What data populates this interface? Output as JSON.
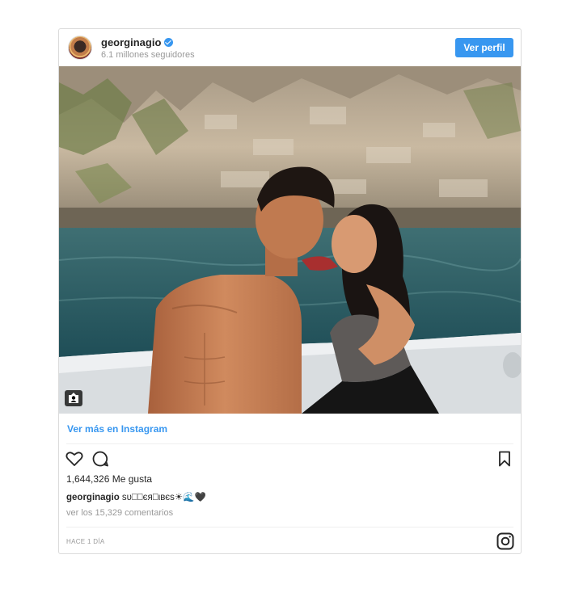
{
  "header": {
    "username": "georginagio",
    "followers": "6.1 millones seguidores",
    "view_profile_label": "Ver perfil"
  },
  "post": {
    "more_link": "Ver más en Instagram",
    "likes": "1,644,326 Me gusta",
    "caption_user": "georginagio",
    "caption_text": "ѕυ⎕⎕єя⎕ιвєѕ☀🌊🖤",
    "comments_link": "ver los 15,329 comentarios",
    "timestamp": "HACE 1 DÍA"
  },
  "icons": {
    "verified": "verified-badge-icon",
    "like": "heart-icon",
    "comment": "comment-bubble-icon",
    "save": "bookmark-icon",
    "tagged": "user-tag-icon",
    "instagram": "instagram-logo-icon"
  },
  "colors": {
    "accent": "#3897f0",
    "border": "#dbdbdb",
    "muted": "#999999"
  }
}
